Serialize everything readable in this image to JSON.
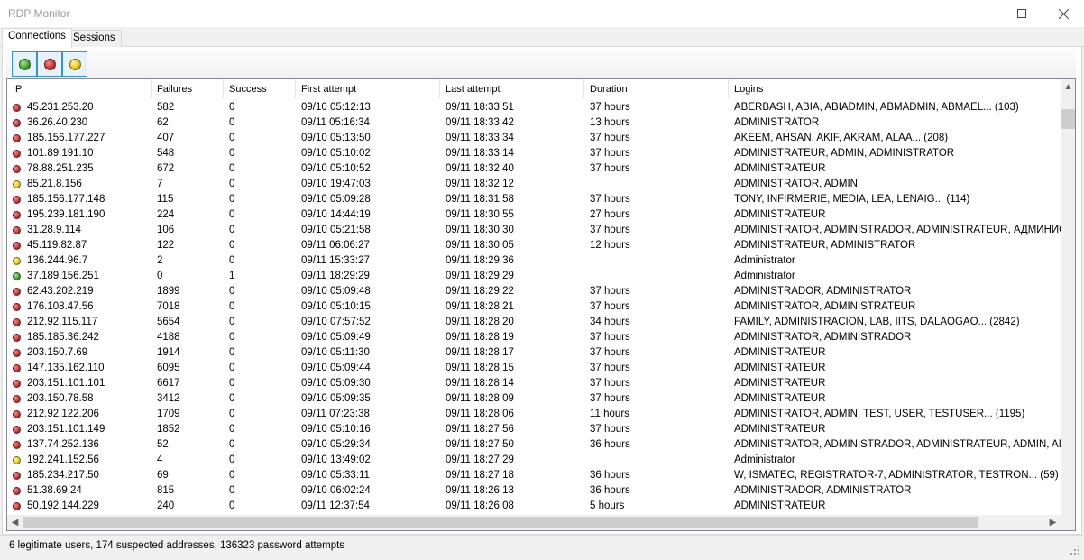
{
  "window": {
    "title": "RDP Monitor"
  },
  "tabs": [
    {
      "label": "Connections",
      "active": true
    },
    {
      "label": "Sessions",
      "active": false
    }
  ],
  "filters": [
    {
      "name": "green",
      "color": "#3d9d2c"
    },
    {
      "name": "red",
      "color": "#c62e2e"
    },
    {
      "name": "yellow",
      "color": "#e3c21a"
    }
  ],
  "columns": [
    "IP",
    "Failures",
    "Success",
    "First attempt",
    "Last attempt",
    "Duration",
    "Logins"
  ],
  "rows": [
    {
      "status": "red",
      "ip": "45.231.253.20",
      "failures": "582",
      "success": "0",
      "first": "09/10 05:12:13",
      "last": "09/11 18:33:51",
      "duration": "37 hours",
      "logins": "ABERBASH, ABIA, ABIADMIN, ABMADMIN, ABMAEL... (103)"
    },
    {
      "status": "red",
      "ip": "36.26.40.230",
      "failures": "62",
      "success": "0",
      "first": "09/11 05:16:34",
      "last": "09/11 18:33:42",
      "duration": "13 hours",
      "logins": "ADMINISTRATOR"
    },
    {
      "status": "red",
      "ip": "185.156.177.227",
      "failures": "407",
      "success": "0",
      "first": "09/10 05:13:50",
      "last": "09/11 18:33:34",
      "duration": "37 hours",
      "logins": "AKEEM, AHSAN, AKIF, AKRAM, ALAA... (208)"
    },
    {
      "status": "red",
      "ip": "101.89.191.10",
      "failures": "548",
      "success": "0",
      "first": "09/10 05:10:02",
      "last": "09/11 18:33:14",
      "duration": "37 hours",
      "logins": "ADMINISTRATEUR, ADMIN, ADMINISTRATOR"
    },
    {
      "status": "red",
      "ip": "78.88.251.235",
      "failures": "672",
      "success": "0",
      "first": "09/10 05:10:52",
      "last": "09/11 18:32:40",
      "duration": "37 hours",
      "logins": "ADMINISTRATEUR"
    },
    {
      "status": "yellow",
      "ip": "85.21.8.156",
      "failures": "7",
      "success": "0",
      "first": "09/10 19:47:03",
      "last": "09/11 18:32:12",
      "duration": "",
      "logins": "ADMINISTRATOR, ADMIN"
    },
    {
      "status": "red",
      "ip": "185.156.177.148",
      "failures": "115",
      "success": "0",
      "first": "09/10 05:09:28",
      "last": "09/11 18:31:58",
      "duration": "37 hours",
      "logins": "TONY, INFIRMERIE, MEDIA, LEA, LENAIG... (114)"
    },
    {
      "status": "red",
      "ip": "195.239.181.190",
      "failures": "224",
      "success": "0",
      "first": "09/10 14:44:19",
      "last": "09/11 18:30:55",
      "duration": "27 hours",
      "logins": "ADMINISTRATEUR"
    },
    {
      "status": "red",
      "ip": "31.28.9.114",
      "failures": "106",
      "success": "0",
      "first": "09/10 05:21:58",
      "last": "09/11 18:30:30",
      "duration": "37 hours",
      "logins": "ADMINISTRATOR, ADMINISTRADOR, ADMINISTRATEUR, АДМИНИСТ"
    },
    {
      "status": "red",
      "ip": "45.119.82.87",
      "failures": "122",
      "success": "0",
      "first": "09/11 06:06:27",
      "last": "09/11 18:30:05",
      "duration": "12 hours",
      "logins": "ADMINISTRATEUR, ADMINISTRATOR"
    },
    {
      "status": "yellow",
      "ip": "136.244.96.7",
      "failures": "2",
      "success": "0",
      "first": "09/11 15:33:27",
      "last": "09/11 18:29:36",
      "duration": "",
      "logins": "Administrator"
    },
    {
      "status": "green",
      "ip": "37.189.156.251",
      "failures": "0",
      "success": "1",
      "first": "09/11 18:29:29",
      "last": "09/11 18:29:29",
      "duration": "",
      "logins": "Administrator"
    },
    {
      "status": "red",
      "ip": "62.43.202.219",
      "failures": "1899",
      "success": "0",
      "first": "09/10 05:09:48",
      "last": "09/11 18:29:22",
      "duration": "37 hours",
      "logins": "ADMINISTRADOR, ADMINISTRATOR"
    },
    {
      "status": "red",
      "ip": "176.108.47.56",
      "failures": "7018",
      "success": "0",
      "first": "09/10 05:10:15",
      "last": "09/11 18:28:21",
      "duration": "37 hours",
      "logins": "ADMINISTRATOR, ADMINISTRATEUR"
    },
    {
      "status": "red",
      "ip": "212.92.115.117",
      "failures": "5654",
      "success": "0",
      "first": "09/10 07:57:52",
      "last": "09/11 18:28:20",
      "duration": "34 hours",
      "logins": "FAMILY, ADMINISTRACION, LAB, IITS, DALAOGAO... (2842)"
    },
    {
      "status": "red",
      "ip": "185.185.36.242",
      "failures": "4188",
      "success": "0",
      "first": "09/10 05:09:49",
      "last": "09/11 18:28:19",
      "duration": "37 hours",
      "logins": "ADMINISTRATOR, ADMINISTRADOR"
    },
    {
      "status": "red",
      "ip": "203.150.7.69",
      "failures": "1914",
      "success": "0",
      "first": "09/10 05:11:30",
      "last": "09/11 18:28:17",
      "duration": "37 hours",
      "logins": "ADMINISTRATEUR"
    },
    {
      "status": "red",
      "ip": "147.135.162.110",
      "failures": "6095",
      "success": "0",
      "first": "09/10 05:09:44",
      "last": "09/11 18:28:15",
      "duration": "37 hours",
      "logins": "ADMINISTRATEUR"
    },
    {
      "status": "red",
      "ip": "203.151.101.101",
      "failures": "6617",
      "success": "0",
      "first": "09/10 05:09:30",
      "last": "09/11 18:28:14",
      "duration": "37 hours",
      "logins": "ADMINISTRATEUR"
    },
    {
      "status": "red",
      "ip": "203.150.78.58",
      "failures": "3412",
      "success": "0",
      "first": "09/10 05:09:35",
      "last": "09/11 18:28:09",
      "duration": "37 hours",
      "logins": "ADMINISTRATEUR"
    },
    {
      "status": "red",
      "ip": "212.92.122.206",
      "failures": "1709",
      "success": "0",
      "first": "09/11 07:23:38",
      "last": "09/11 18:28:06",
      "duration": "11 hours",
      "logins": "ADMINISTRATOR, ADMIN, TEST, USER, TESTUSER... (1195)"
    },
    {
      "status": "red",
      "ip": "203.151.101.149",
      "failures": "1852",
      "success": "0",
      "first": "09/10 05:10:16",
      "last": "09/11 18:27:56",
      "duration": "37 hours",
      "logins": "ADMINISTRATEUR"
    },
    {
      "status": "red",
      "ip": "137.74.252.136",
      "failures": "52",
      "success": "0",
      "first": "09/10 05:29:34",
      "last": "09/11 18:27:50",
      "duration": "36 hours",
      "logins": "ADMINISTRATOR, ADMINISTRADOR, ADMINISTRATEUR, ADMIN, ADM"
    },
    {
      "status": "yellow",
      "ip": "192.241.152.56",
      "failures": "4",
      "success": "0",
      "first": "09/10 13:49:02",
      "last": "09/11 18:27:29",
      "duration": "",
      "logins": "Administrator"
    },
    {
      "status": "red",
      "ip": "185.234.217.50",
      "failures": "69",
      "success": "0",
      "first": "09/10 05:33:11",
      "last": "09/11 18:27:18",
      "duration": "36 hours",
      "logins": "W, ISMATEC, REGISTRATOR-7, ADMINISTRATOR, TESTRON... (59)"
    },
    {
      "status": "red",
      "ip": "51.38.69.24",
      "failures": "815",
      "success": "0",
      "first": "09/10 06:02:24",
      "last": "09/11 18:26:13",
      "duration": "36 hours",
      "logins": "ADMINISTRADOR, ADMINISTRATOR"
    },
    {
      "status": "red",
      "ip": "50.192.144.229",
      "failures": "240",
      "success": "0",
      "first": "09/11 12:37:54",
      "last": "09/11 18:26:08",
      "duration": "5 hours",
      "logins": "ADMINISTRATEUR"
    }
  ],
  "status": {
    "text": "6 legitimate users, 174 suspected addresses, 136323 password attempts"
  }
}
